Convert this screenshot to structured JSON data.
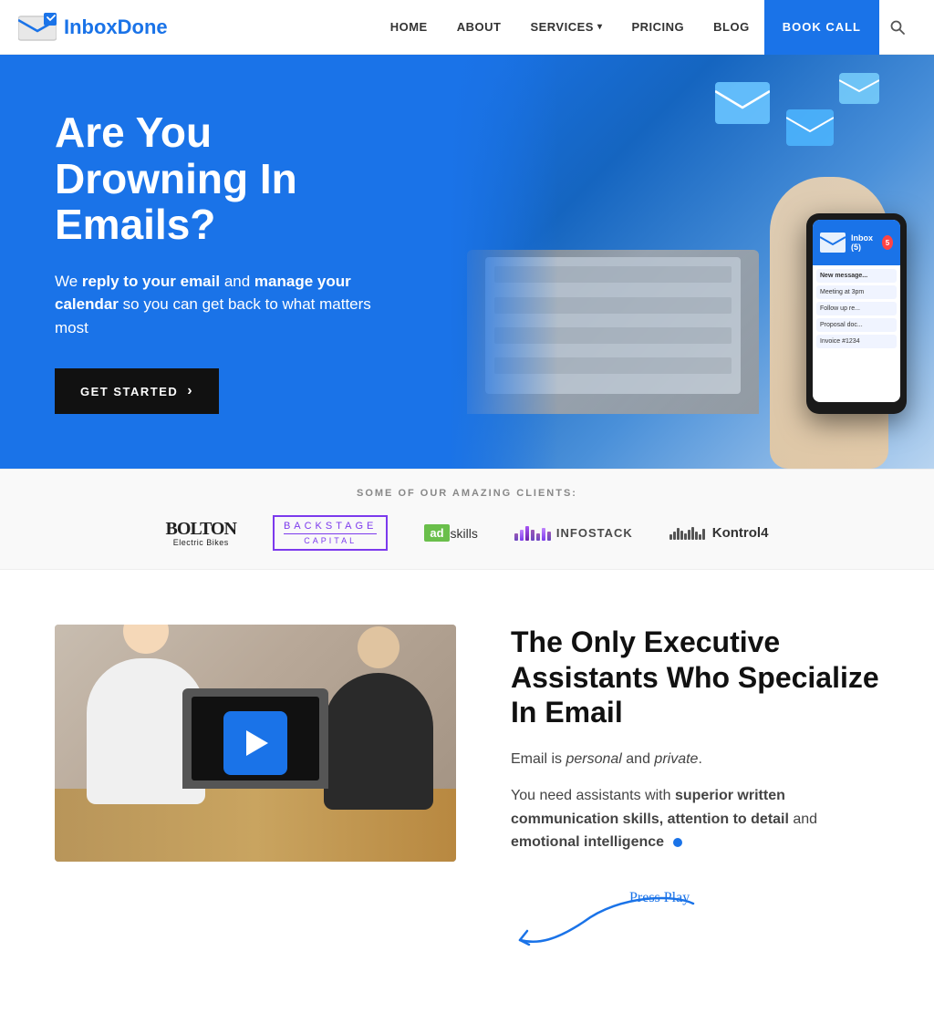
{
  "header": {
    "logo_text_inbox": "Inbox",
    "logo_text_done": "Done",
    "nav": {
      "home": "HOME",
      "about": "ABOUT",
      "services": "SERVICES",
      "pricing": "PRICING",
      "blog": "BLOG",
      "book_call": "BOOK CALL"
    }
  },
  "hero": {
    "title": "Are You Drowning In Emails?",
    "subtitle_plain": "We ",
    "subtitle_bold1": "reply to your email",
    "subtitle_mid": " and ",
    "subtitle_bold2": "manage your calendar",
    "subtitle_end": " so you can get back to what matters most",
    "cta_button": "GET STARTED"
  },
  "clients": {
    "label": "SOME OF OUR AMAZING CLIENTS:",
    "logos": [
      {
        "name": "Bolton Electric Bikes",
        "type": "bolton"
      },
      {
        "name": "Backstage Capital",
        "type": "backstage"
      },
      {
        "name": "adskills",
        "type": "adskills"
      },
      {
        "name": "INFOSTACK",
        "type": "infostack"
      },
      {
        "name": "Kontrol4",
        "type": "kontrol4"
      }
    ]
  },
  "exec_section": {
    "title": "The Only Executive Assistants Who Specialize In Email",
    "desc1_plain": "Email is ",
    "desc1_italic1": "personal",
    "desc1_mid": " and ",
    "desc1_italic2": "private",
    "desc1_end": ".",
    "desc2_plain": "You need assistants with ",
    "desc2_bold1": "superior written communication skills, attention to detail",
    "desc2_mid": " and ",
    "desc2_bold2": "emotional intelligence",
    "press_play": "Press Play"
  }
}
